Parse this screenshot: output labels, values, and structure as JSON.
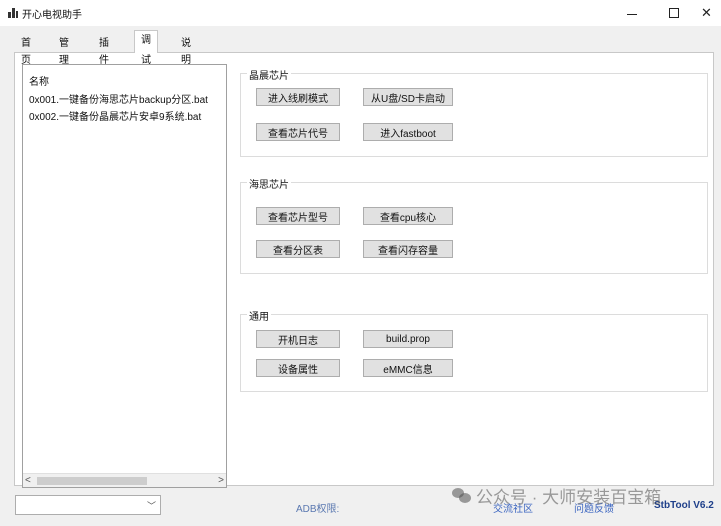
{
  "window": {
    "title": "开心电视助手",
    "minimize_symbol": "—",
    "maximize_symbol": "☐",
    "close_symbol": "✕"
  },
  "tabs": [
    {
      "label": "首页",
      "active": false
    },
    {
      "label": "管理",
      "active": false
    },
    {
      "label": "插件",
      "active": false
    },
    {
      "label": "调试",
      "active": true
    },
    {
      "label": "说明",
      "active": false
    }
  ],
  "script_list": {
    "header": "名称",
    "items": [
      "0x001.一键备份海思芯片backup分区.bat",
      "0x002.一键备份晶晨芯片安卓9系统.bat"
    ],
    "scroll_left": "<",
    "scroll_right": ">"
  },
  "groups": {
    "amlogic": {
      "title": "晶晨芯片",
      "buttons": [
        "进入线刷模式",
        "从U盘/SD卡启动",
        "查看芯片代号",
        "进入fastboot"
      ]
    },
    "hisilicon": {
      "title": "海思芯片",
      "buttons": [
        "查看芯片型号",
        "查看cpu核心",
        "查看分区表",
        "查看闪存容量"
      ]
    },
    "general": {
      "title": "通用",
      "buttons": [
        "开机日志",
        "build.prop",
        "设备属性",
        "eMMC信息"
      ]
    }
  },
  "statusbar": {
    "device_combo_value": "",
    "adb_label": "ADB权限:",
    "community_link": "交流社区",
    "feedback_link": "问题反馈",
    "version": "StbTool V6.2"
  },
  "watermark": {
    "text": "公众号 · 大师安装百宝箱"
  }
}
